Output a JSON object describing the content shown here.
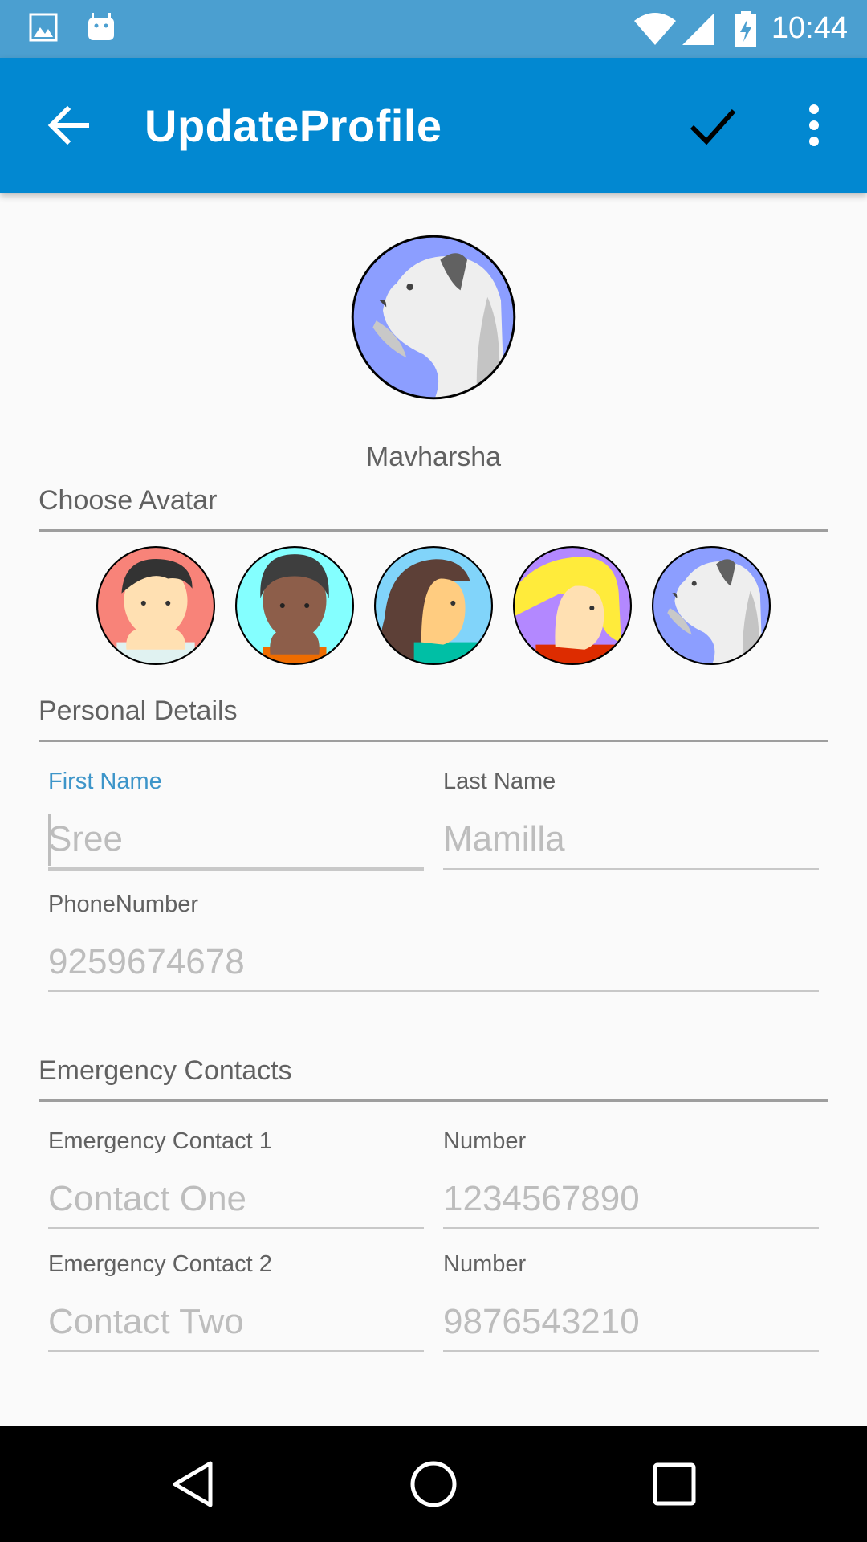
{
  "status_bar": {
    "time": "10:44",
    "icons": [
      "gallery-icon",
      "android-icon",
      "wifi-icon",
      "signal-icon",
      "battery-charging-icon"
    ]
  },
  "app_bar": {
    "title": "UpdateProfile",
    "icons": [
      "back-arrow-icon",
      "check-icon",
      "more-vert-icon"
    ],
    "color": "#0288d1"
  },
  "profile": {
    "username": "Mavharsha",
    "avatar": "dog-avatar"
  },
  "choose_avatar": {
    "title": "Choose Avatar",
    "avatars": [
      "boy-avatar",
      "dark-boy-avatar",
      "brunette-girl-avatar",
      "blonde-girl-avatar",
      "dog-avatar"
    ]
  },
  "personal_details": {
    "title": "Personal Details",
    "first_name": {
      "label": "First Name",
      "placeholder": "Sree"
    },
    "last_name": {
      "label": "Last Name",
      "placeholder": "Mamilla"
    },
    "phone": {
      "label": "PhoneNumber",
      "placeholder": "9259674678"
    }
  },
  "emergency_contacts": {
    "title": "Emergency Contacts",
    "contact1": {
      "label": "Emergency Contact 1",
      "placeholder": "Contact One",
      "number_label": "Number",
      "number_placeholder": "1234567890"
    },
    "contact2": {
      "label": "Emergency Contact 2",
      "placeholder": "Contact Two",
      "number_label": "Number",
      "number_placeholder": "9876543210"
    }
  },
  "nav_bar": {
    "icons": [
      "nav-back-icon",
      "nav-home-icon",
      "nav-recents-icon"
    ]
  },
  "colors": {
    "accent": "#3d95c9",
    "status_bar": "#4b9fd0"
  }
}
